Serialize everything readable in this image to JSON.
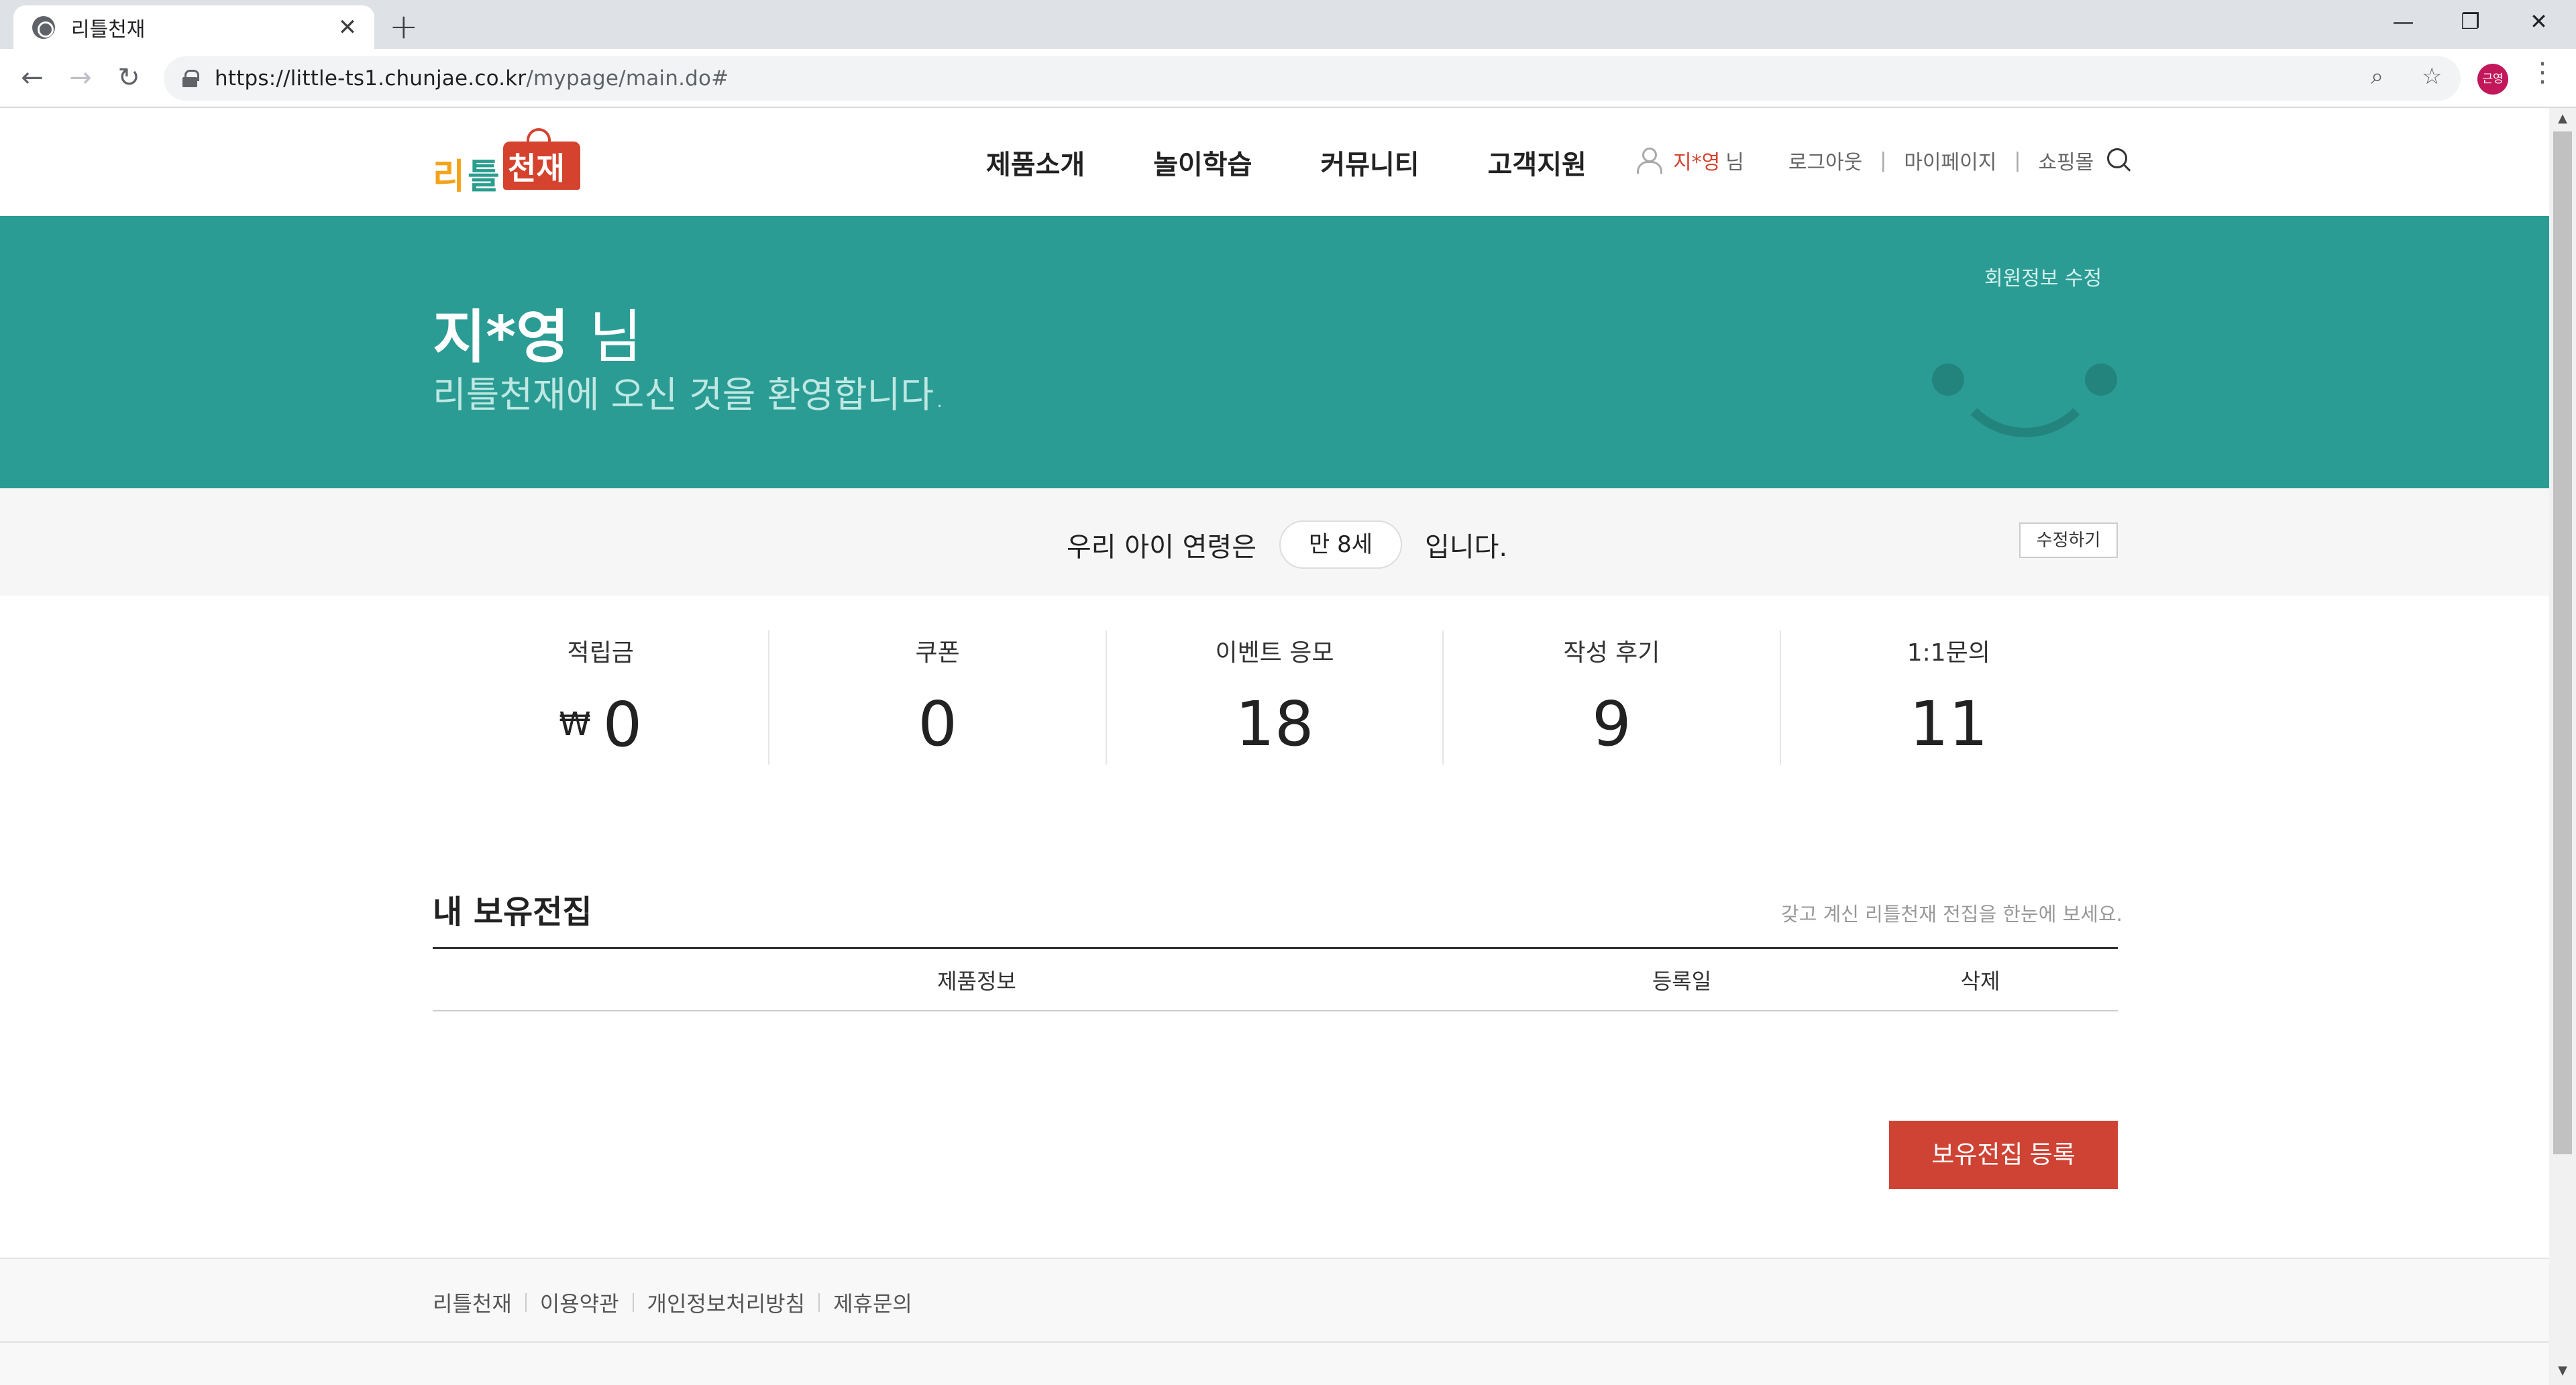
{
  "browser": {
    "tab_title": "리틀천재",
    "tab_close": "✕",
    "new_tab": "+",
    "url_host": "https://little-ts1.chunjae.co.kr",
    "url_path": "/mypage/main.do#",
    "profile_initials": "근영",
    "window_controls": {
      "minimize": "—",
      "maximize": "❐",
      "close": "✕"
    },
    "nav": {
      "back": "←",
      "forward": "→",
      "reload": "↻"
    },
    "icons": {
      "zoom": "⌕",
      "star": "☆",
      "menu": "⋮"
    }
  },
  "header": {
    "logo": {
      "part1": "리",
      "part2": "틀",
      "part3": "천재"
    },
    "gnb": [
      "제품소개",
      "놀이학습",
      "커뮤니티",
      "고객지원"
    ],
    "user_name": "지*영",
    "user_suffix": "님",
    "logout": "로그아웃",
    "mypage": "마이페이지",
    "shop": "쇼핑몰",
    "sep": "|"
  },
  "hero": {
    "name": "지*영",
    "nim": "님",
    "welcome": "리틀천재에 오신 것을 환영합니다.",
    "edit_member": "회원정보 수정",
    "bg_color": "#2b9c94"
  },
  "age": {
    "prefix": "우리 아이 연령은",
    "value": "만 8세",
    "suffix": "입니다.",
    "edit": "수정하기"
  },
  "stats": [
    {
      "label": "적립금",
      "value": "0",
      "currency": "₩"
    },
    {
      "label": "쿠폰",
      "value": "0"
    },
    {
      "label": "이벤트 응모",
      "value": "18"
    },
    {
      "label": "작성 후기",
      "value": "9"
    },
    {
      "label": "1:1문의",
      "value": "11"
    }
  ],
  "books": {
    "title": "내 보유전집",
    "desc": "갖고 계신 리틀천재 전집을 한눈에 보세요.",
    "columns": [
      "제품정보",
      "등록일",
      "삭제"
    ],
    "register_button": "보유전집 등록",
    "button_color": "#cf4334"
  },
  "footer": {
    "links": [
      "리틀천재",
      "이용약관",
      "개인정보처리방침",
      "제휴문의"
    ]
  }
}
